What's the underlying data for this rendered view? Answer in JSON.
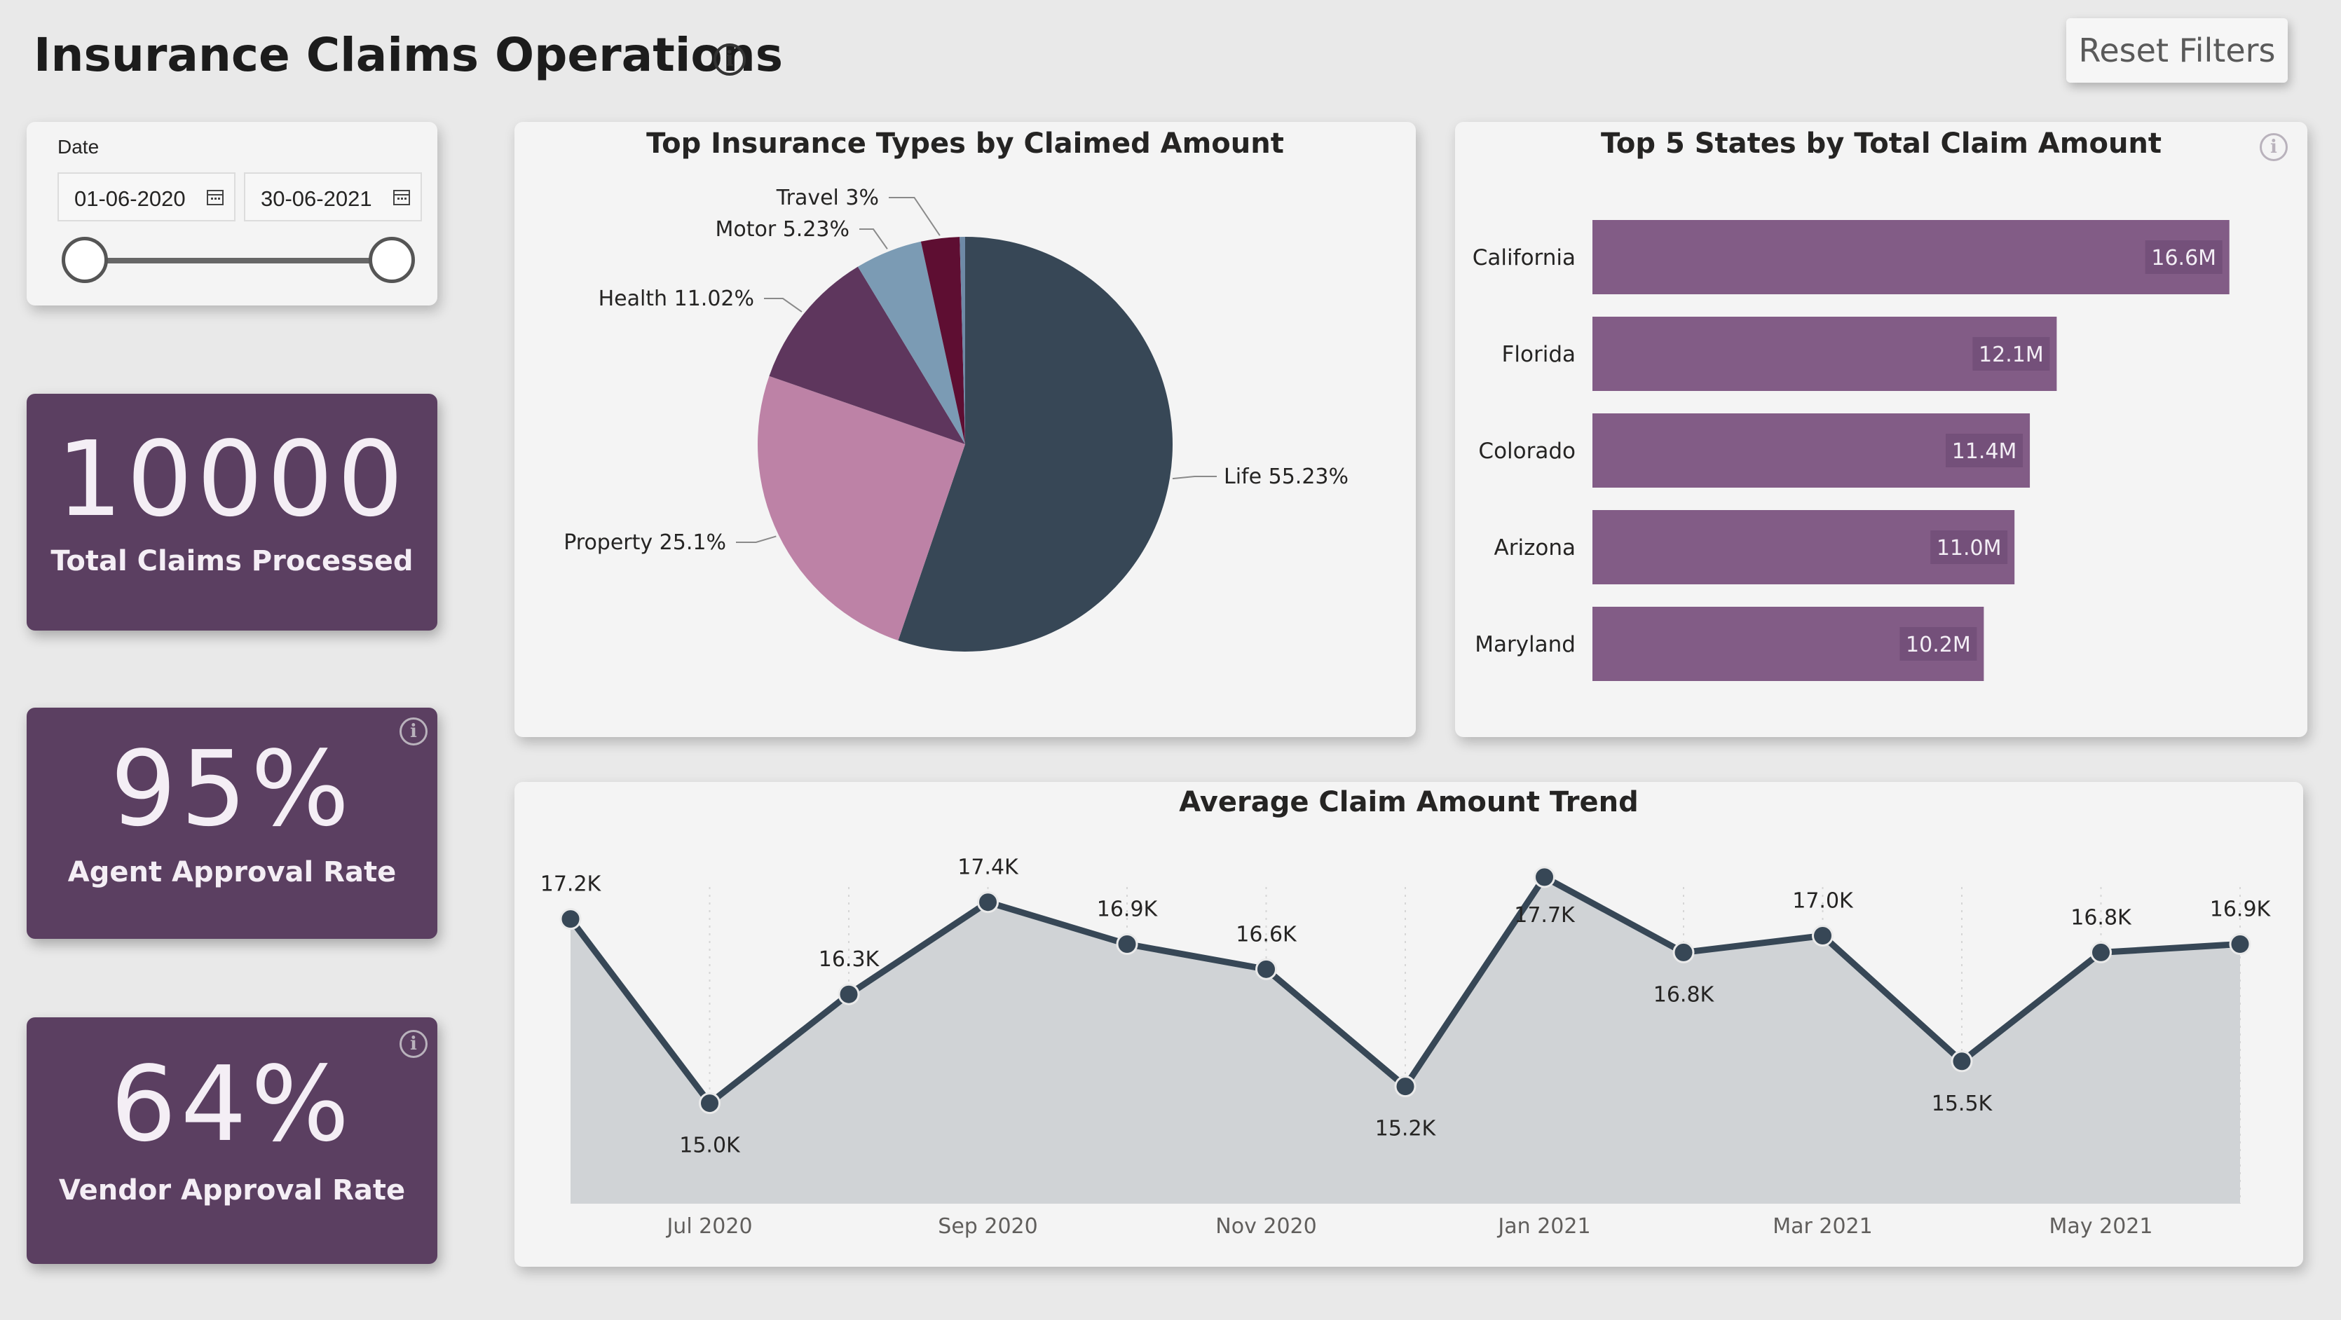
{
  "header": {
    "title": "Insurance Claims Operations",
    "reset_label": "Reset Filters"
  },
  "slicer": {
    "label": "Date",
    "start": "01-06-2020",
    "end": "30-06-2021"
  },
  "kpis": [
    {
      "value": "10000",
      "label": "Total Claims Processed"
    },
    {
      "value": "95%",
      "label": "Agent Approval Rate"
    },
    {
      "value": "64%",
      "label": "Vendor Approval Rate"
    }
  ],
  "colors": {
    "kpi_bg": "#5b3f61",
    "bar": "#825c86",
    "line": "#374756",
    "area": "#d0d3d6"
  },
  "chart_data": [
    {
      "type": "pie",
      "title": "Top Insurance Types by Claimed Amount",
      "slices": [
        {
          "name": "Life",
          "label": "Life 55.23%",
          "value": 55.23,
          "color": "#374756"
        },
        {
          "name": "Property",
          "label": "Property 25.1%",
          "value": 25.1,
          "color": "#bd82a6"
        },
        {
          "name": "Health",
          "label": "Health 11.02%",
          "value": 11.02,
          "color": "#5e365d"
        },
        {
          "name": "Motor",
          "label": "Motor 5.23%",
          "value": 5.23,
          "color": "#7b9bb4"
        },
        {
          "name": "Travel",
          "label": "Travel 3%",
          "value": 3,
          "color": "#5e0e32"
        },
        {
          "name": "Other",
          "label": "",
          "value": 0.42,
          "color": "#6f8aa6"
        }
      ]
    },
    {
      "type": "bar",
      "title": "Top 5 States by Total Claim Amount",
      "categories": [
        "California",
        "Florida",
        "Colorado",
        "Arizona",
        "Maryland"
      ],
      "values": [
        16.6,
        12.1,
        11.4,
        11.0,
        10.2
      ],
      "value_labels": [
        "16.6M",
        "12.1M",
        "11.4M",
        "11.0M",
        "10.2M"
      ],
      "xlim": [
        0,
        17.5
      ]
    },
    {
      "type": "area",
      "title": "Average Claim Amount Trend",
      "x": [
        "Jun 2020",
        "Jul 2020",
        "Aug 2020",
        "Sep 2020",
        "Oct 2020",
        "Nov 2020",
        "Dec 2020",
        "Jan 2021",
        "Feb 2021",
        "Mar 2021",
        "Apr 2021",
        "May 2021",
        "Jun 2021"
      ],
      "values": [
        17.2,
        15.0,
        16.3,
        17.4,
        16.9,
        16.6,
        15.2,
        17.7,
        16.8,
        17.0,
        15.5,
        16.8,
        16.9
      ],
      "value_labels": [
        "17.2K",
        "15.0K",
        "16.3K",
        "17.4K",
        "16.9K",
        "16.6K",
        "15.2K",
        "17.7K",
        "16.8K",
        "17.0K",
        "15.5K",
        "16.8K",
        "16.9K"
      ],
      "tick_labels": [
        "Jul 2020",
        "Sep 2020",
        "Nov 2020",
        "Jan 2021",
        "Mar 2021",
        "May 2021"
      ],
      "ylim": [
        13.8,
        18.0
      ]
    }
  ]
}
